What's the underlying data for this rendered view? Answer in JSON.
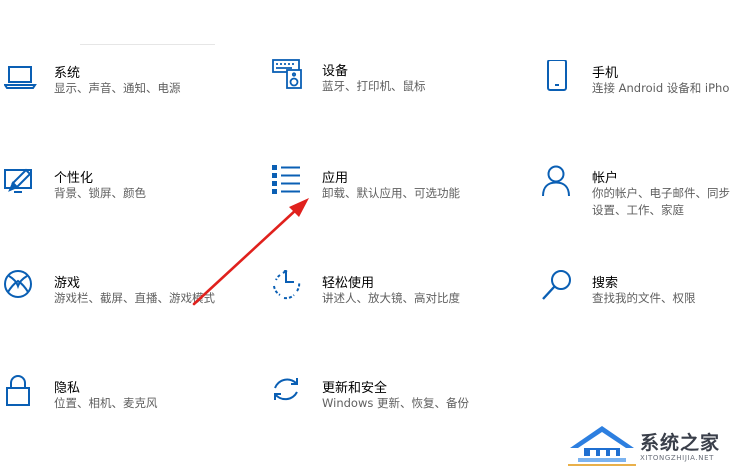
{
  "accent_color": "#0a5fb4",
  "settings": [
    {
      "title": "系统",
      "desc": "显示、声音、通知、电源",
      "icon": "laptop-icon"
    },
    {
      "title": "设备",
      "desc": "蓝牙、打印机、鼠标",
      "icon": "keyboard-speaker-icon"
    },
    {
      "title": "手机",
      "desc": "连接 Android 设备和 iPho",
      "icon": "phone-icon"
    },
    {
      "title": "个性化",
      "desc": "背景、锁屏、颜色",
      "icon": "personalization-icon"
    },
    {
      "title": "应用",
      "desc": "卸载、默认应用、可选功能",
      "icon": "apps-list-icon"
    },
    {
      "title": "帐户",
      "desc": "你的帐户、电子邮件、同步设置、工作、家庭",
      "icon": "person-icon"
    },
    {
      "title": "游戏",
      "desc": "游戏栏、截屏、直播、游戏模式",
      "icon": "xbox-icon"
    },
    {
      "title": "轻松使用",
      "desc": "讲述人、放大镜、高对比度",
      "icon": "ease-of-access-icon"
    },
    {
      "title": "搜索",
      "desc": "查找我的文件、权限",
      "icon": "search-icon"
    },
    {
      "title": "隐私",
      "desc": "位置、相机、麦克风",
      "icon": "lock-icon"
    },
    {
      "title": "更新和安全",
      "desc": "Windows 更新、恢复、备份",
      "icon": "sync-icon"
    }
  ],
  "watermark": {
    "text": "系统之家",
    "sub": "XITONGZHIJIA.NET",
    "icon": "house-logo-icon"
  },
  "annotation": {
    "color": "#e0211d",
    "icon": "red-arrow-annotation"
  }
}
